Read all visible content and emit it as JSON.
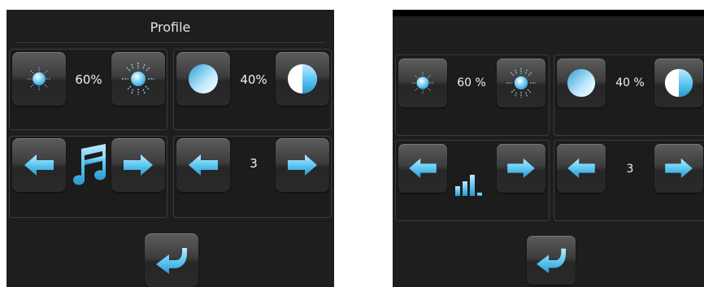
{
  "left": {
    "title": "Profile",
    "brightness_value": "60%",
    "contrast_value": "40%",
    "page_value": "3"
  },
  "right": {
    "brightness_value": "60 %",
    "contrast_value": "40 %",
    "page_value": "3"
  },
  "colors": {
    "background": "#1e1e1e",
    "accent": "#5ec8f2",
    "text": "#f0f0f0"
  },
  "icons": {
    "brightness_low": "sun-small-icon",
    "brightness_high": "sun-large-icon",
    "contrast_low": "circle-full-icon",
    "contrast_high": "circle-half-icon",
    "prev": "arrow-left-icon",
    "next": "arrow-right-icon",
    "sound": "music-note-icon",
    "volume": "volume-bars-icon",
    "back": "return-arrow-icon"
  }
}
